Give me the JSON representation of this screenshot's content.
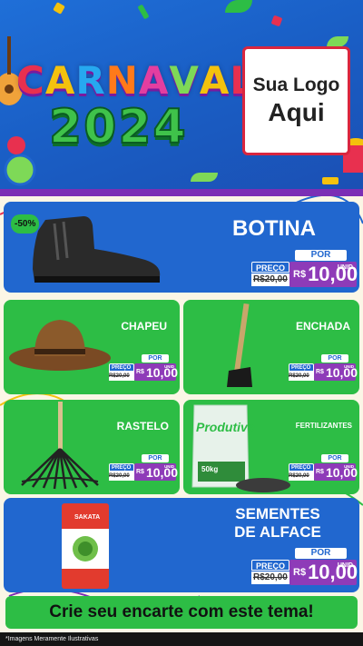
{
  "banner": {
    "title_letters": [
      "C",
      "A",
      "R",
      "N",
      "A",
      "V",
      "A",
      "L"
    ],
    "letter_colors": [
      "#e8304f",
      "#f4c20d",
      "#26a8f0",
      "#ff7a1a",
      "#e33ea0",
      "#7ed957",
      "#f4c20d",
      "#e8304f"
    ],
    "year": "2024",
    "logo_line1": "Sua Logo",
    "logo_line2": "Aqui"
  },
  "products": [
    {
      "name": "BOTINA",
      "discount": "-50%",
      "por": "POR",
      "preco": "PREÇO",
      "old": "R$20,00",
      "currency": "R$",
      "price": "10,00",
      "unit": "UNID"
    },
    {
      "name": "CHAPEU",
      "por": "POR",
      "preco": "PREÇO",
      "old": "R$20,00",
      "currency": "R$",
      "price": "10,00",
      "unit": "UNID"
    },
    {
      "name": "ENCHADA",
      "por": "POR",
      "preco": "PREÇO",
      "old": "R$20,00",
      "currency": "R$",
      "price": "10,00",
      "unit": "UNID"
    },
    {
      "name": "RASTELO",
      "por": "POR",
      "preco": "PREÇO",
      "old": "R$20,00",
      "currency": "R$",
      "price": "10,00",
      "unit": "UNID"
    },
    {
      "name": "FERTILIZANTES",
      "por": "POR",
      "preco": "PREÇO",
      "old": "R$20,00",
      "currency": "R$",
      "price": "10,00",
      "unit": "UNID",
      "pkg_brand": "Produtive",
      "pkg_weight": "50kg"
    },
    {
      "name": "SEMENTES DE ALFACE",
      "por": "POR",
      "preco": "PREÇO",
      "old": "R$20,00",
      "currency": "R$",
      "price": "10,00",
      "unit": "UNID",
      "pkg_brand": "SAKATA"
    }
  ],
  "cta": "Crie seu encarte com este tema!",
  "footer": "*Imagens Meramente Ilustrativas",
  "colors": {
    "blue": "#2167cf",
    "green": "#2dbd45",
    "purple": "#8e3bb8",
    "banner": "#1f6fd8"
  }
}
